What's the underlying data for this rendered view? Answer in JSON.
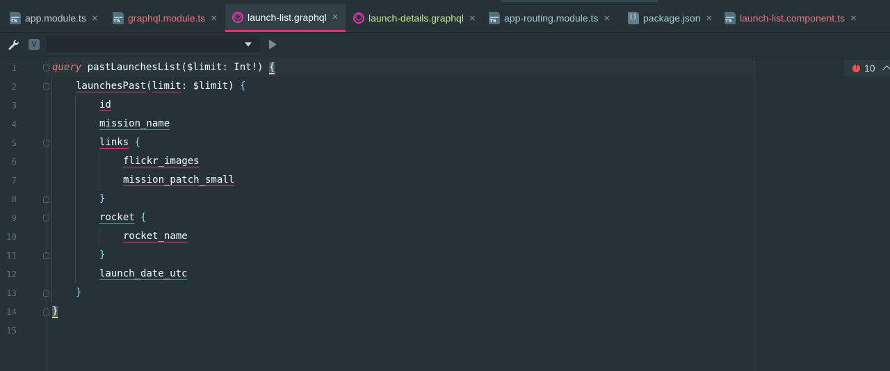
{
  "tabs": [
    {
      "label": "app.module.ts",
      "icon": "typescript-file-icon",
      "color": "#c3cdd2",
      "active": false
    },
    {
      "label": "graphql.module.ts",
      "icon": "typescript-file-icon",
      "color": "#f07178",
      "active": false
    },
    {
      "label": "launch-list.graphql",
      "icon": "graphql-file-icon",
      "color": "#eeffff",
      "active": true
    },
    {
      "label": "launch-details.graphql",
      "icon": "graphql-file-icon",
      "color": "#c3e88d",
      "active": false
    },
    {
      "label": "app-routing.module.ts",
      "icon": "typescript-file-icon",
      "color": "#9ccfd8",
      "active": false
    },
    {
      "label": "package.json",
      "icon": "json-file-icon",
      "color": "#9ccfd8",
      "active": false
    },
    {
      "label": "launch-list.component.ts",
      "icon": "typescript-file-icon",
      "color": "#f07178",
      "active": false
    }
  ],
  "toolbar": {
    "v_badge": "V",
    "endpoint_value": ""
  },
  "editor": {
    "line_numbers": [
      "1",
      "2",
      "3",
      "4",
      "5",
      "6",
      "7",
      "8",
      "9",
      "10",
      "11",
      "12",
      "13",
      "14",
      "15"
    ],
    "error_count": "10",
    "code": {
      "l1_kw": "query",
      "l1_name": "pastLaunchesList",
      "l1_args": "($limit: Int!)",
      "l1_brace": "{",
      "l2_field": "launchesPast",
      "l2_paren_open": "(",
      "l2_arg": "limit",
      "l2_rest": ": $limit) ",
      "l2_brace": "{",
      "l3": "id",
      "l4": "mission_name",
      "l5": "links",
      "l5_brace": "{",
      "l6": "flickr_images",
      "l7": "mission_patch_small",
      "l8": "}",
      "l9": "rocket",
      "l9_brace": "{",
      "l10": "rocket_name",
      "l11": "}",
      "l12": "launch_date_utc",
      "l13": "}",
      "l14": "}"
    }
  },
  "colors": {
    "accent": "#e8316f",
    "background": "#263238",
    "keyword": "#f07178",
    "brace": "#89ddff"
  }
}
